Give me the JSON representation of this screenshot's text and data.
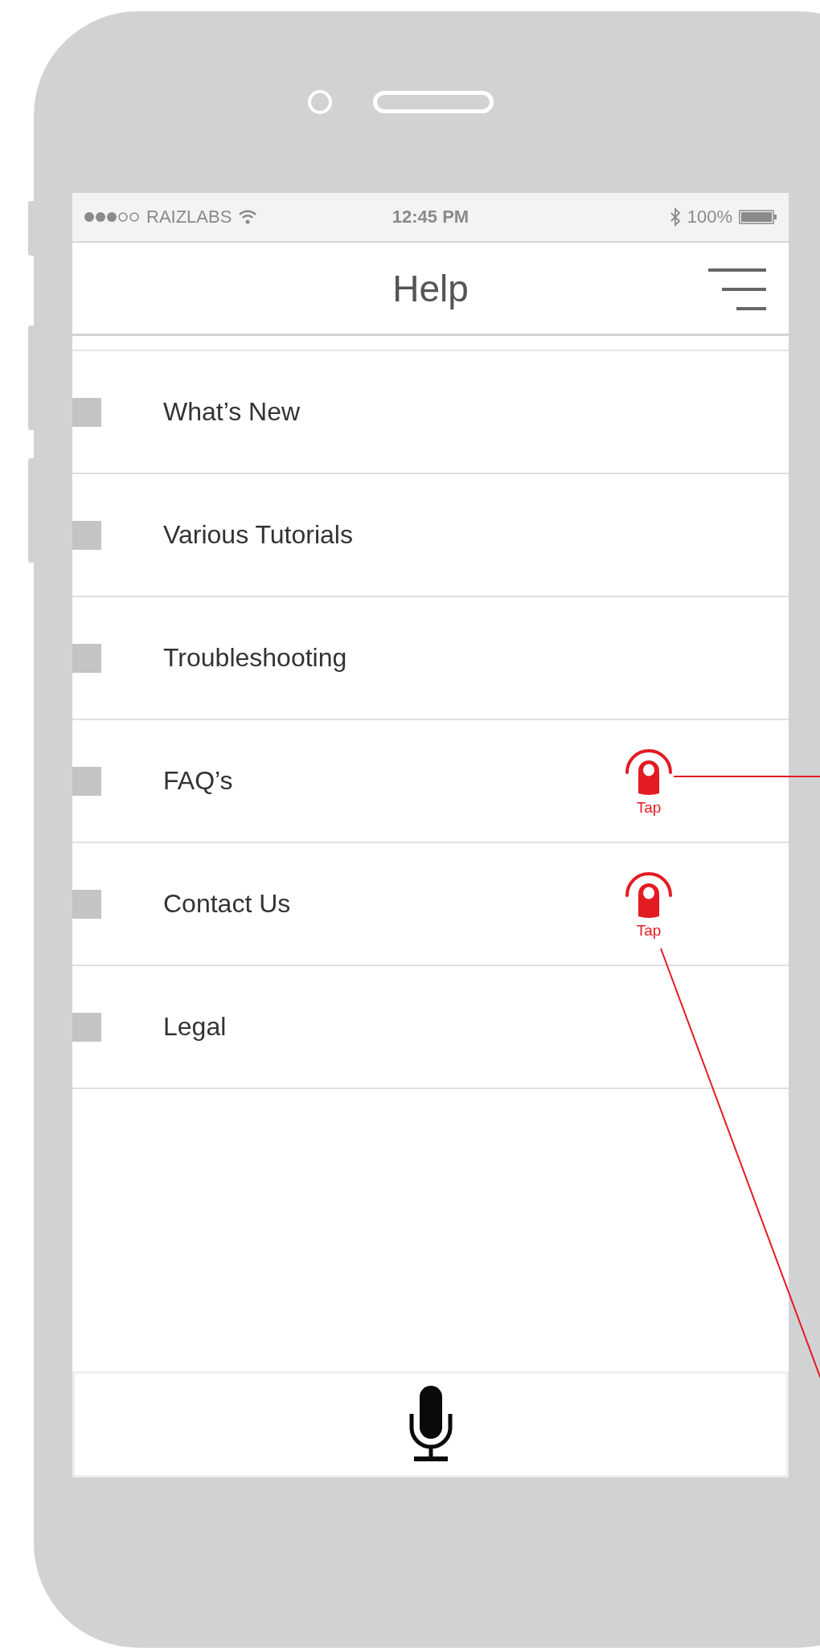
{
  "status_bar": {
    "carrier": "RAIZLABS",
    "time": "12:45 PM",
    "battery": "100%"
  },
  "header": {
    "title": "Help"
  },
  "items": [
    {
      "label": "What’s New"
    },
    {
      "label": "Various Tutorials"
    },
    {
      "label": "Troubleshooting"
    },
    {
      "label": "FAQ’s",
      "tap_hint": "Tap"
    },
    {
      "label": "Contact Us",
      "tap_hint": "Tap"
    },
    {
      "label": "Legal"
    }
  ]
}
